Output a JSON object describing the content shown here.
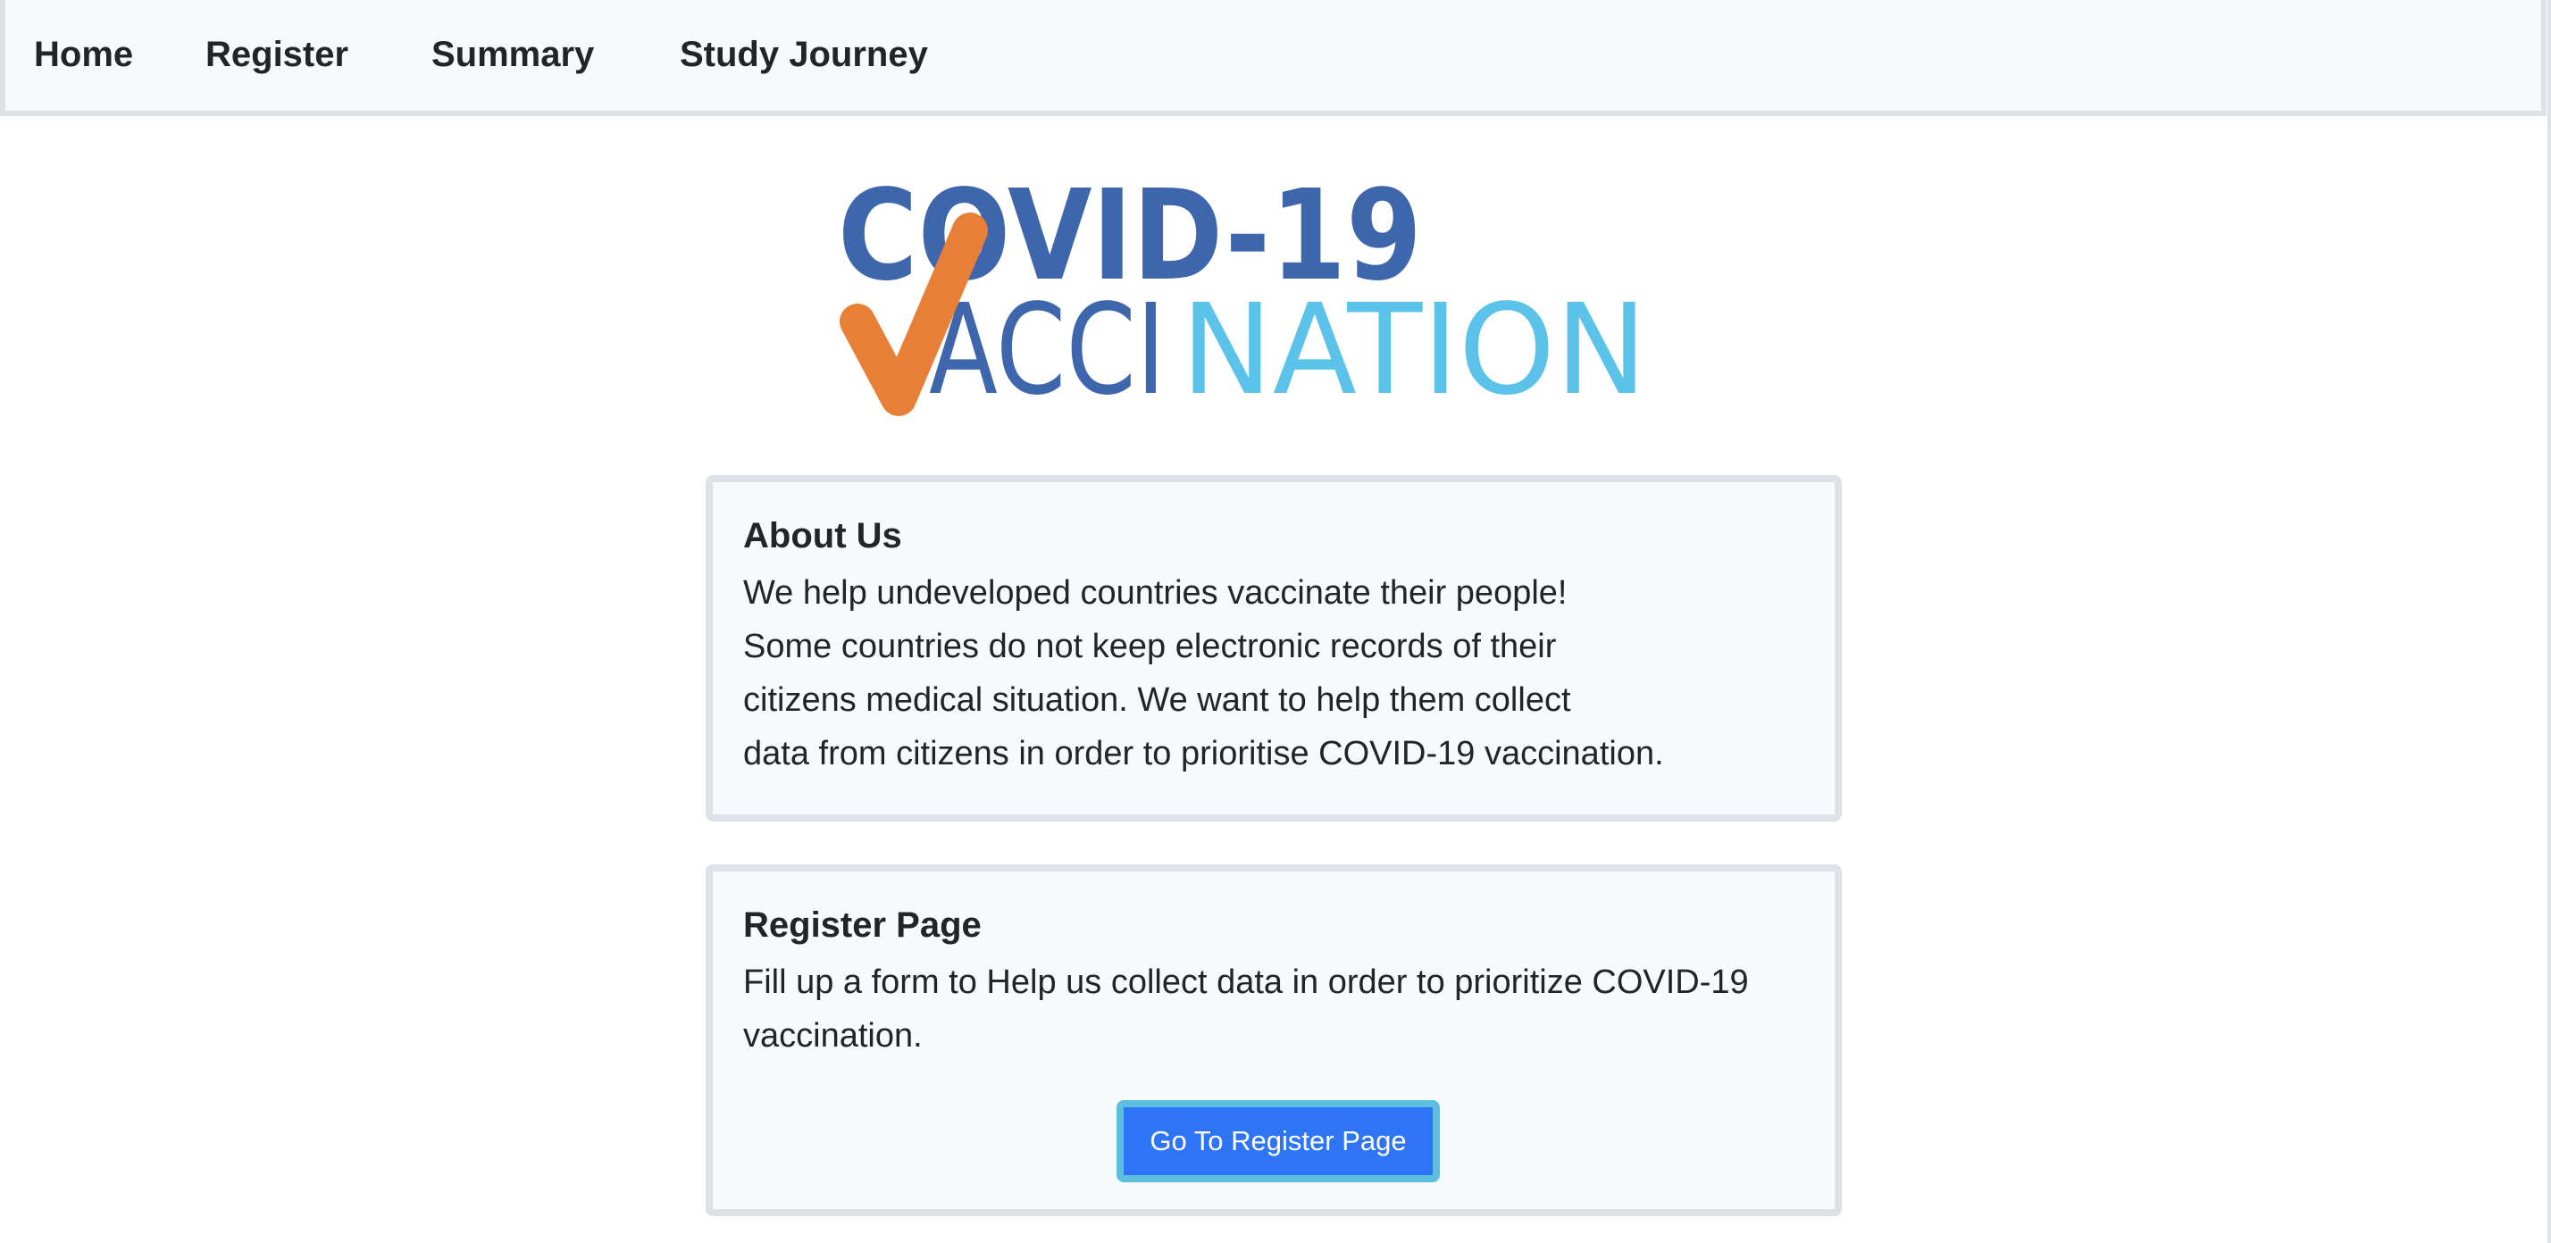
{
  "nav": {
    "items": [
      {
        "label": "Home"
      },
      {
        "label": "Register"
      },
      {
        "label": "Summary"
      },
      {
        "label": "Study Journey"
      }
    ]
  },
  "logo": {
    "line1": "COVID-19",
    "line2_dark": "ACCI",
    "line2_light": "NATION",
    "colors": {
      "dark_blue": "#3d66ad",
      "light_blue": "#5bc2ea",
      "orange": "#e87f37"
    }
  },
  "about": {
    "title": "About Us",
    "lines": [
      "We help undeveloped countries vaccinate their people!",
      "Some countries do not keep electronic records of their",
      "citizens medical situation. We want to help them collect",
      "data from citizens in order to prioritise COVID-19 vaccination."
    ]
  },
  "register": {
    "title": "Register Page",
    "lines": [
      "Fill up a form to Help us collect data in order to prioritize COVID-19",
      "vaccination."
    ],
    "button_label": "Go To Register Page"
  },
  "colors": {
    "primary_button": "#2f74f5",
    "button_focus_ring": "#5bc0de",
    "card_background": "#f8f9fa",
    "card_border": "#dee2e6"
  }
}
